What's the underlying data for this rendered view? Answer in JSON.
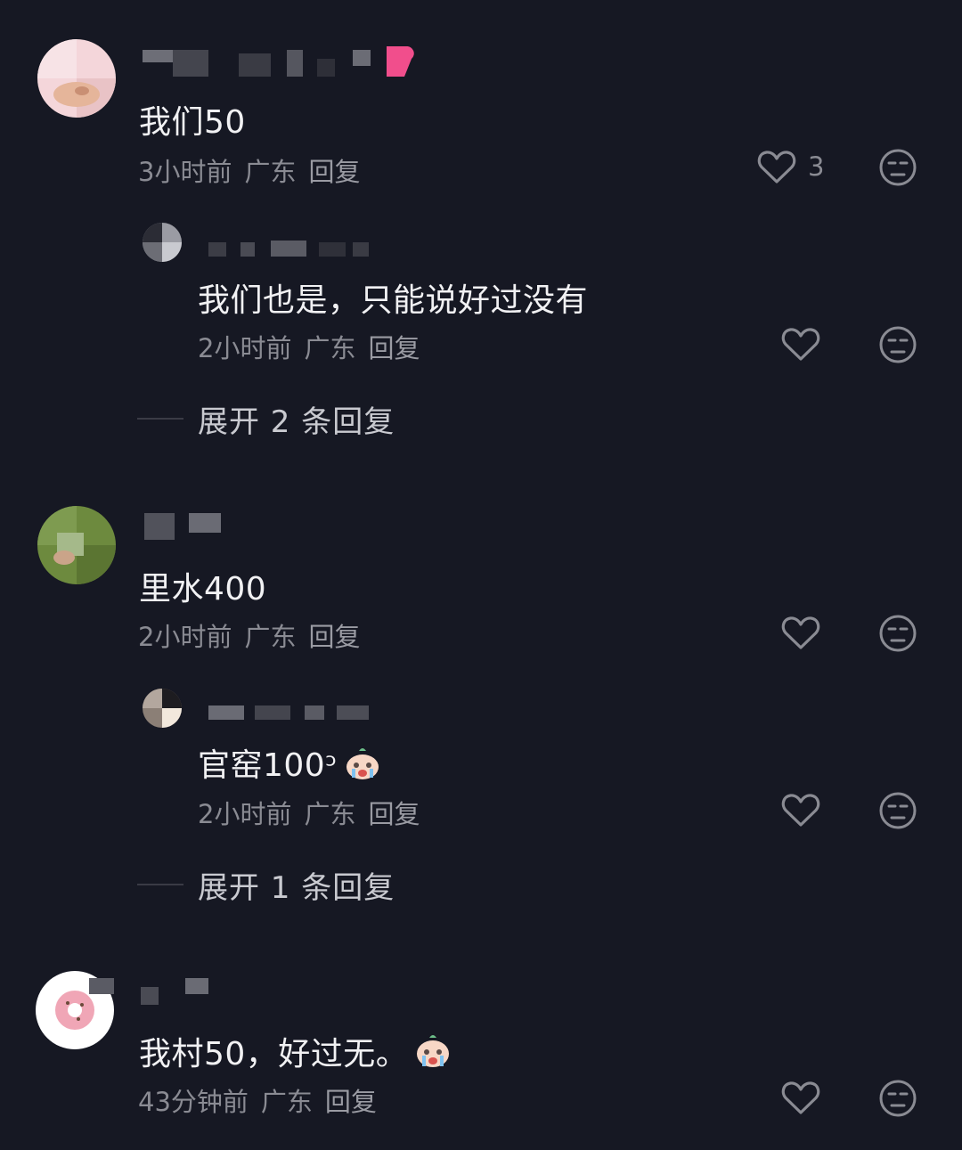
{
  "comments": [
    {
      "text": "我们50",
      "time": "3小时前",
      "location": "广东",
      "reply_label": "回复",
      "like_count": "3",
      "replies": [
        {
          "text": "我们也是，只能说好过没有",
          "time": "2小时前",
          "location": "广东",
          "reply_label": "回复"
        }
      ],
      "expand_label": "展开 2 条回复"
    },
    {
      "text": "里水400",
      "time": "2小时前",
      "location": "广东",
      "reply_label": "回复",
      "replies": [
        {
          "text": "官窑100ᵓ",
          "time": "2小时前",
          "location": "广东",
          "reply_label": "回复",
          "emoji": "crying-face-emoji"
        }
      ],
      "expand_label": "展开 1 条回复"
    },
    {
      "text": "我村50，好过无。",
      "time": "43分钟前",
      "location": "广东",
      "reply_label": "回复",
      "emoji": "crying-face-emoji"
    }
  ],
  "icons": {
    "like": "heart-outline-icon",
    "dislike": "unamused-face-icon"
  },
  "colors": {
    "background": "#161823",
    "text": "#f1f1f3",
    "meta": "#8a8b93"
  }
}
